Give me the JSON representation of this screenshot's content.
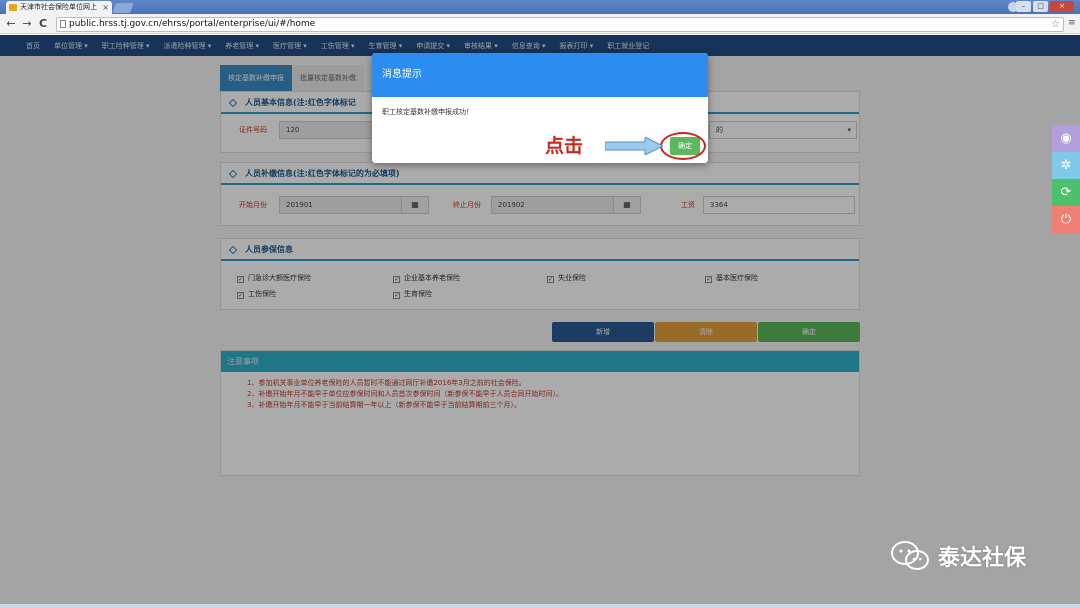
{
  "browser": {
    "tab_title": "天津市社会保险单位网上",
    "tab_close": "×",
    "url": "public.hrss.tj.gov.cn/ehrss/portal/enterprise/ui/#/home",
    "back": "←",
    "forward": "→",
    "reload": "C",
    "star": "☆",
    "menu": "≡",
    "win_min": "–",
    "win_max": "□",
    "win_close": "×"
  },
  "nav": {
    "items": [
      "首页",
      "单位管理 ▾",
      "职工险种管理 ▾",
      "派遣险种管理 ▾",
      "养老管理 ▾",
      "医疗管理 ▾",
      "工伤管理 ▾",
      "生育管理 ▾",
      "申请提交 ▾",
      "审核结果 ▾",
      "信息查询 ▾",
      "报表打印 ▾",
      "职工就业登记"
    ]
  },
  "tabs": [
    "核定基数补缴申报",
    "批量核定基数补缴"
  ],
  "section1": {
    "title": "人员基本信息(注:红色字体标记",
    "id_label": "证件号码",
    "id_value": "120",
    "select_value": "的"
  },
  "section2": {
    "title": "人员补缴信息(注:红色字体标记的为必填项)",
    "start_label": "开始月份",
    "start_value": "201901",
    "end_label": "终止月份",
    "end_value": "201902",
    "wage_label": "工资",
    "wage_value": "3364",
    "cal_icon": "▦"
  },
  "section3": {
    "title": "人员参保信息",
    "insurances": [
      "门急诊大额医疗保险",
      "企业基本养老保险",
      "失业保险",
      "基本医疗保险",
      "工伤保险",
      "生育保险"
    ],
    "check_mark": "✓"
  },
  "buttons": {
    "new": "新增",
    "clear": "清除",
    "confirm": "确定",
    "colors": {
      "new": "#2a5a94",
      "clear": "#e0a23c",
      "confirm": "#5cb85c"
    }
  },
  "notes": {
    "title": "注意事项",
    "items": [
      "1、参加机关事业单位养老保险的人员暂时不能通过网厅补缴2016年3月之前的社会保险。",
      "2、补缴开始年月不能早于单位应参保时间和人员首次参保时间（新参保不能早于人员合同开始时间）。",
      "3、补缴开始年月不能早于当前结算期一年以上（新参保不能早于当前结算期前三个月）。"
    ]
  },
  "modal": {
    "title": "消息提示",
    "message": "职工核定基数补缴申报成功！",
    "ok": "确定"
  },
  "annotation": {
    "text": "点击"
  },
  "side_buttons": [
    {
      "icon": "eye-icon",
      "glyph": "◉",
      "color": "#b39ddb"
    },
    {
      "icon": "tree-icon",
      "glyph": "✲",
      "color": "#81c9e8"
    },
    {
      "icon": "refresh-icon",
      "glyph": "⟳",
      "color": "#4cc06a"
    },
    {
      "icon": "power-icon",
      "glyph": "⏻",
      "color": "#f07f73"
    }
  ],
  "watermark": {
    "text": "泰达社保"
  }
}
